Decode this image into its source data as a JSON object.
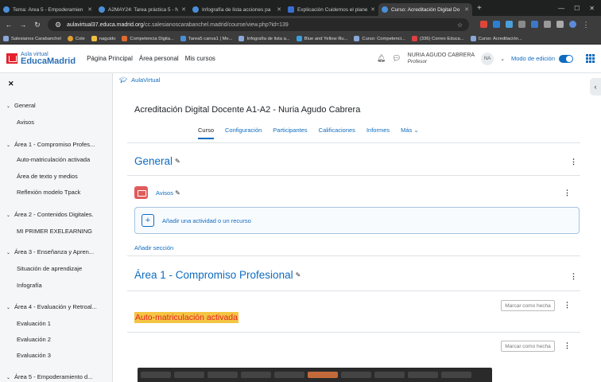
{
  "browser": {
    "tabs": [
      {
        "label": "Tema: Área 5 - Empoderamien",
        "active": false
      },
      {
        "label": "A2MAY24: Tarea práctica 5 - N",
        "active": false
      },
      {
        "label": "Infografía de lista acciones pa",
        "active": false
      },
      {
        "label": "Explicación Cuidemos el planet",
        "active": false
      },
      {
        "label": "Curso: Acreditación Digital Do",
        "active": true
      }
    ],
    "new_tab": "+",
    "url_host": "aulavirtual37.educa.madrid.org",
    "url_path": "/cc.salesianoscarabanchel.madrid/course/view.php?id=139",
    "bookmarks": [
      "Salesianos Carabanchel",
      "Cole",
      "naguido",
      "Competencia Digita...",
      "Tarea5 canva1 | Me...",
      "Infografía de lista a...",
      "Blue and Yellow Illu...",
      "Curso: Competenci...",
      "(336) Correo Educa...",
      "Curso: Acreditación..."
    ]
  },
  "header": {
    "logo_small": "Aula virtual",
    "logo_big": "EducaMadrid",
    "nav": [
      "Página Principal",
      "Área personal",
      "Mis cursos"
    ],
    "user_name": "NURIA AGUDO CABRERA",
    "user_role": "Profesor",
    "avatar_initials": "NA",
    "edit_mode_label": "Modo de edición"
  },
  "course_index": {
    "sections": [
      {
        "title": "General",
        "items": [
          "Avisos"
        ]
      },
      {
        "title": "Área 1 - Compromiso Profes...",
        "items": [
          "Auto-matriculación activada",
          "Área de texto y medios",
          "Reflexión modelo Tpack"
        ]
      },
      {
        "title": "Área 2 - Contenidos Digitales.",
        "items": [
          "MI PRIMER EXELEARNING"
        ]
      },
      {
        "title": "Área 3 - Enseñanza y Apren...",
        "items": [
          "Situación de aprendizaje",
          "Infografía"
        ]
      },
      {
        "title": "Área 4 - Evaluación y Retroal...",
        "items": [
          "Evaluación 1",
          "Evaluación 2",
          "Evaluación 3"
        ]
      },
      {
        "title": "Área 5 - Empoderamiento d...",
        "items": []
      }
    ]
  },
  "main": {
    "breadcrumb": "AulaVirtual",
    "course_title": "Acreditación Digital Docente A1-A2 - Nuria Agudo Cabrera",
    "tabs": [
      "Curso",
      "Configuración",
      "Participantes",
      "Calificaciones",
      "Informes",
      "Más"
    ],
    "section_general": "General",
    "avisos": "Avisos",
    "add_activity": "Añadir una actividad o un recurso",
    "add_section": "Añadir sección",
    "section_area1": "Área 1 - Compromiso Profesional",
    "mark_done": "Marcar como hecha",
    "highlighted_activity": "Auto-matriculación activada"
  }
}
